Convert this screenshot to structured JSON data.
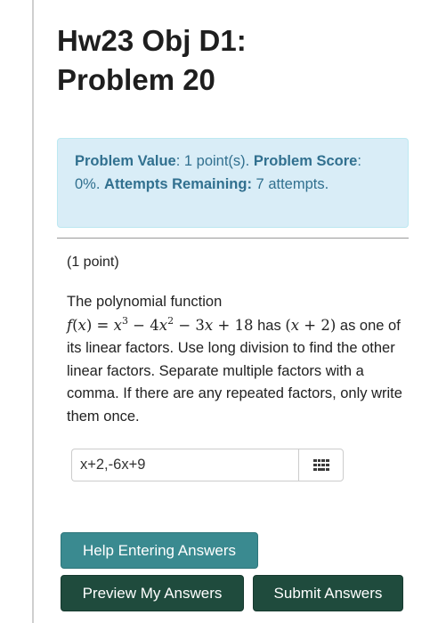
{
  "page": {
    "title_line1": "Hw23 Obj D1:",
    "title_line2": "Problem 20"
  },
  "info": {
    "problem_value_label": "Problem Value",
    "problem_value": ": 1 point(s). ",
    "problem_score_label": "Problem Score",
    "problem_score": ": 0%. ",
    "attempts_label": "Attempts Remaining:",
    "attempts_value": " 7 attempts."
  },
  "problem": {
    "points": "(1 point)",
    "intro": "The polynomial function",
    "text_after_function": " has ",
    "text_after_factor": " as one of its linear factors. Use long division to find the other linear factors. Separate multiple factors with a comma. If there are any repeated factors, only write them once."
  },
  "answer": {
    "value": "x+2,-6x+9"
  },
  "buttons": {
    "help": "Help Entering Answers",
    "preview": "Preview My Answers",
    "submit": "Submit Answers"
  },
  "colors": {
    "info_bg": "#d9edf7",
    "info_text": "#31708f",
    "help_button": "#3a8a90",
    "primary_button": "#1f4b3d"
  },
  "icons": {
    "palette": "grid-keypad-icon"
  }
}
